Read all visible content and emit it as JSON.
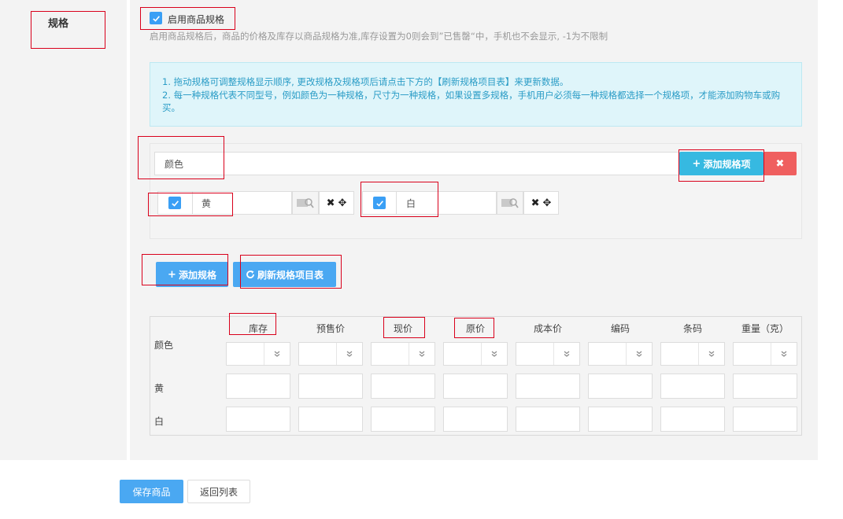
{
  "section": {
    "label": "规格"
  },
  "enable_spec": {
    "checked": true,
    "label": "启用商品规格",
    "hint": "启用商品规格后，商品的价格及库存以商品规格为准,库存设置为0则会到”已售罄“中，手机也不会显示, -1为不限制"
  },
  "info": {
    "line1": "1. 拖动规格可调整规格显示顺序, 更改规格及规格项后请点击下方的【刷新规格项目表】来更新数据。",
    "line2": "2. 每一种规格代表不同型号，例如颜色为一种规格，尺寸为一种规格，如果设置多规格，手机用户必须每一种规格都选择一个规格项，才能添加购物车或购买。"
  },
  "spec_group": {
    "name": "颜色",
    "add_item_label": "添加规格项",
    "delete_symbol": "✖",
    "items": [
      {
        "checked": true,
        "value": "黄"
      },
      {
        "checked": true,
        "value": "白"
      }
    ]
  },
  "buttons": {
    "add_spec": "添加规格",
    "refresh_table": "刷新规格项目表"
  },
  "table": {
    "row_header": "颜色",
    "columns": [
      "库存",
      "预售价",
      "现价",
      "原价",
      "成本价",
      "编码",
      "条码",
      "重量（克）"
    ],
    "rows": [
      "黄",
      "白"
    ]
  },
  "footer": {
    "save": "保存商品",
    "back": "返回列表"
  },
  "colors": {
    "primary": "#4aa8f2",
    "cyan": "#36b9e1",
    "danger": "#ef5f5f",
    "info_bg": "#dff5fa",
    "info_text": "#2a9cc6",
    "annotation": "#d9001b"
  }
}
